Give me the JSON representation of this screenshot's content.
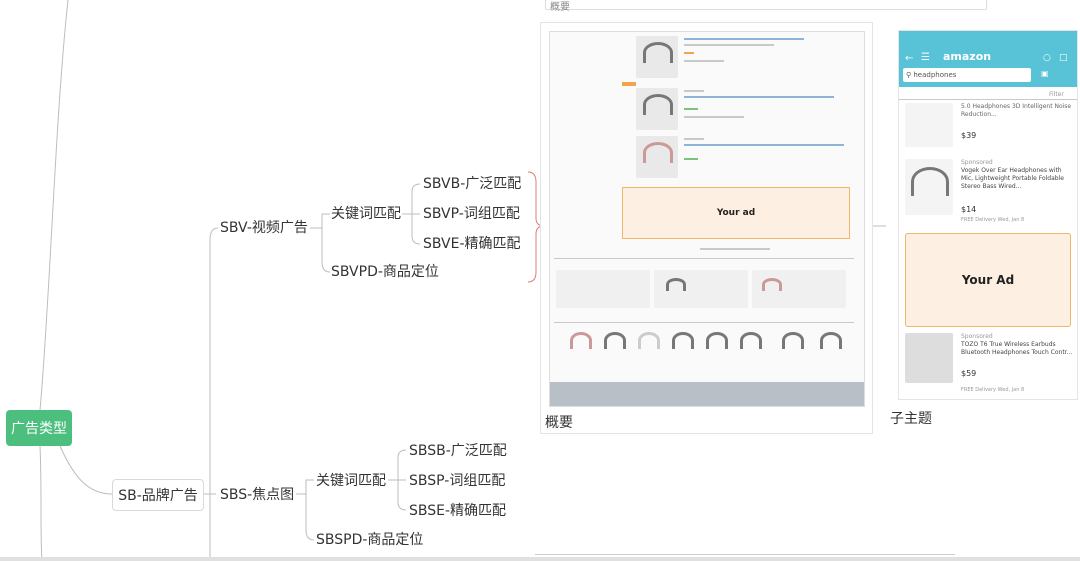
{
  "mindmap": {
    "root": "广告类型",
    "sb": "SB-品牌广告",
    "sbv": "SBV-视频广告",
    "sbv_keyword": "关键词匹配",
    "sbvb": "SBVB-广泛匹配",
    "sbvp": "SBVP-词组匹配",
    "sbve": "SBVE-精确匹配",
    "sbvpd": "SBVPD-商品定位",
    "sbs": "SBS-焦点图",
    "sbs_keyword": "关键词匹配",
    "sbsb": "SBSB-广泛匹配",
    "sbsp": "SBSP-词组匹配",
    "sbse": "SBSE-精确匹配",
    "sbspd": "SBSPD-商品定位"
  },
  "panels": {
    "topbar_label": "概要",
    "overview_caption": "概要",
    "subtopic_caption": "子主题",
    "desktop_ad_label": "Your ad",
    "mobile_ad_label": "Your Ad",
    "mobile_brand": "amazon",
    "mobile_search": "headphones",
    "mobile_filter": "Filter",
    "mobile_item1_title": "5.0 Headphones 3D Intelligent Noise Reduction...",
    "mobile_item1_price": "$39",
    "mobile_item2_sponsored": "Sponsored",
    "mobile_item2_title": "Vogek Over Ear Headphones with Mic, Lightweight Portable Foldable Stereo Bass Wired...",
    "mobile_item2_price": "$14",
    "mobile_item3_sponsored": "Sponsored",
    "mobile_item3_title": "TOZO T6 True Wireless Earbuds Bluetooth Headphones Touch Contr...",
    "mobile_item3_price": "$59",
    "mobile_delivery": "FREE Delivery Wed, Jan 8"
  },
  "colors": {
    "root_bg": "#4cbf7f",
    "bracket": "#e07a7a",
    "ad_fill": "#fdf0e3",
    "ad_border": "#f0b46a",
    "phone_header": "#58c2d6"
  }
}
